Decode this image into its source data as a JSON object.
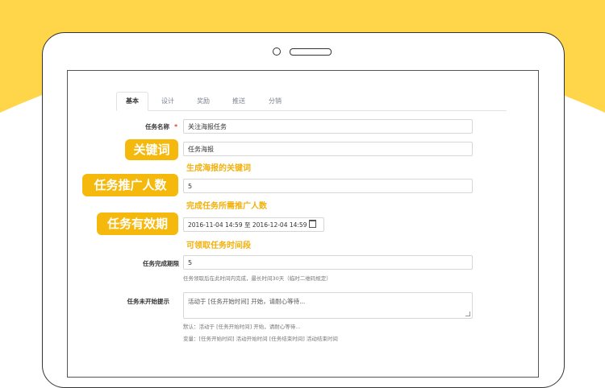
{
  "colors": {
    "accent_yellow": "#FFD54A",
    "badge_yellow": "#F5B90E",
    "required_red": "#E0412B"
  },
  "tabs": [
    {
      "label": "基本",
      "active": true
    },
    {
      "label": "设计",
      "active": false
    },
    {
      "label": "奖励",
      "active": false
    },
    {
      "label": "推送",
      "active": false
    },
    {
      "label": "分销",
      "active": false
    }
  ],
  "form": {
    "task_name_label": "任务名称",
    "required_mark": "*",
    "task_name_value": "关注海报任务",
    "keyword_value": "任务海报",
    "promo_count_value": "5",
    "period_start": "2016-11-04 14:59",
    "period_to": "至",
    "period_end": "2016-12-04 14:59",
    "deadline_label": "任务完成期限",
    "deadline_value": "5",
    "deadline_help": "任务领取后在此时间内完成，最长时间30天（临时二维码规定）",
    "not_started_label": "任务未开始提示",
    "not_started_value": "活动于 [任务开始时间] 开始，请耐心等待...",
    "default_help": "默认：活动于 [任务开始时间] 开始，请耐心等待...",
    "vars_help": "变量：[任务开始时间] 活动开始时间 [任务结束时间] 活动结束时间"
  },
  "annotations": {
    "keyword_badge": "关键词",
    "keyword_note": "生成海报的关键词",
    "promo_badge": "任务推广人数",
    "promo_note": "完成任务所需推广人数",
    "period_badge": "任务有效期",
    "period_note": "可领取任务时间段"
  }
}
